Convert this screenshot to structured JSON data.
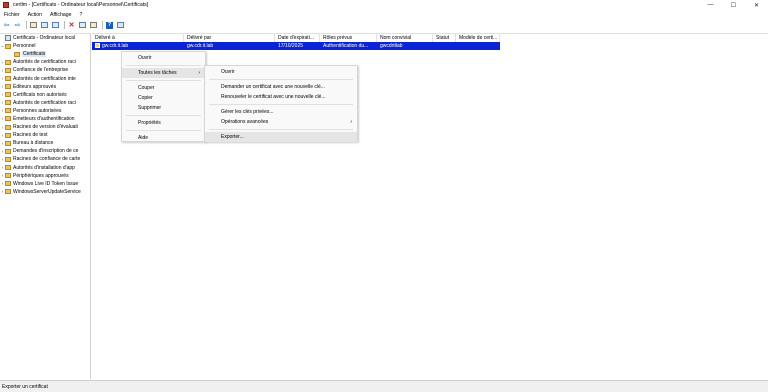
{
  "window": {
    "title": "certlm - [Certificats - Ordinateur local\\Personnel\\Certificats]",
    "controls": {
      "minimize": "—",
      "maximize": "☐",
      "close": "✕"
    }
  },
  "menubar": {
    "items": [
      "Fichier",
      "Action",
      "Affichage",
      "?"
    ]
  },
  "toolbar": {
    "icons": [
      "back-arrow-icon",
      "forward-arrow-icon",
      "folder-up-icon",
      "show-tree-icon",
      "copy-icon",
      "delete-icon",
      "properties-icon",
      "export-icon",
      "help-icon",
      "mmc-icon"
    ]
  },
  "tree": {
    "root": "Certificats - Ordinateur local",
    "personnel": "Personnel",
    "certificats": "Certificats",
    "items": [
      "Autorités de certification raci",
      "Confiance de l'entreprise",
      "Autorités de certification inte",
      "Éditeurs approuvés",
      "Certificats non autorisés",
      "Autorités de certification raci",
      "Personnes autorisées",
      "Émetteurs d'authentification",
      "Racines de version d'évaluati",
      "Racines de test",
      "Bureau à distance",
      "Demandes d'inscription de ce",
      "Racines de confiance de carte",
      "Autorités d'installation d'app",
      "Périphériques approuvés",
      "Windows Live ID Token Issue",
      "WindowsServerUpdateService"
    ]
  },
  "list": {
    "columns": [
      "Délivré à",
      "Délivré par",
      "Date d'expirati...",
      "Rôles prévus",
      "Nom convivial",
      "Statut",
      "Modèle de certi..."
    ],
    "rows": [
      [
        "gw.cdr.it.lab",
        "gw.cdr.it.lab",
        "17/10/2025",
        "Authentification du...",
        "gwcdritlab",
        "",
        ""
      ]
    ]
  },
  "context_menu": {
    "items": [
      "Ouvrir",
      "Toutes les tâches",
      "Couper",
      "Copier",
      "Supprimer",
      "Propriétés",
      "Aide"
    ]
  },
  "submenu": {
    "items": [
      "Ouvrir",
      "Demander un certificat avec une nouvelle clé...",
      "Renouveler le certificat avec une nouvelle clé...",
      "Gérer les clés privées...",
      "Opérations avancées",
      "Exporter..."
    ]
  },
  "statusbar": {
    "text": "Exporter un certificat"
  },
  "colors": {
    "selection": "#0b25d6",
    "folder": "#e9c46a"
  }
}
